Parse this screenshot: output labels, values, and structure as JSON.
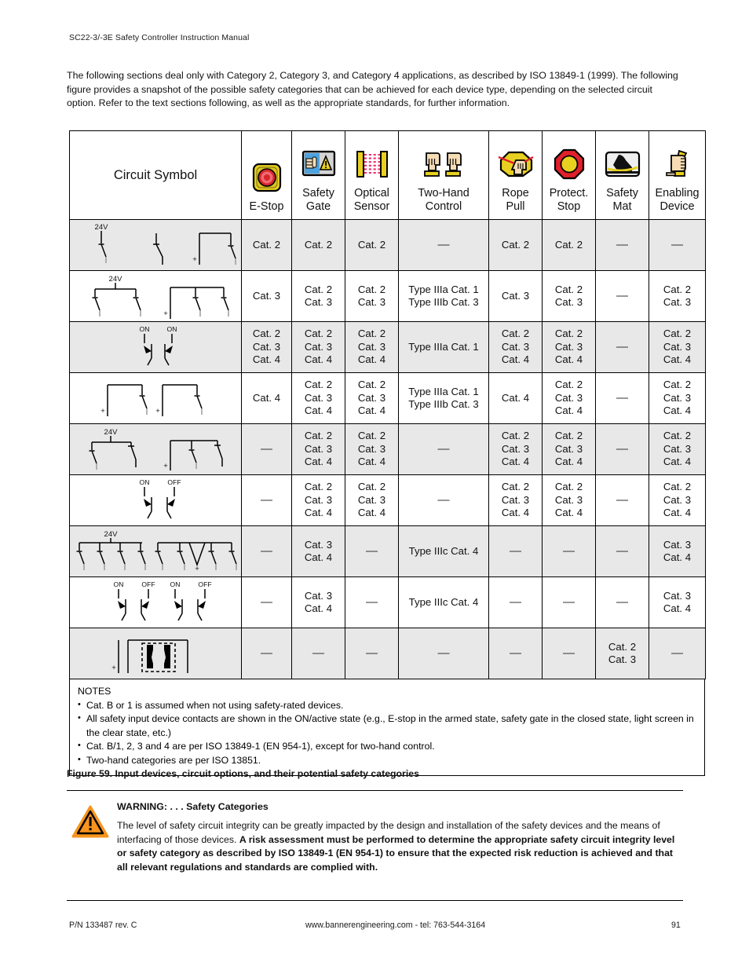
{
  "running_head": "SC22-3/-3E Safety Controller Instruction Manual",
  "intro_paragraph": "The following sections deal only with Category 2, Category 3, and Category 4 applications, as described by ISO 13849-1 (1999). The following figure provides a snapshot of the possible safety categories that can be achieved for each device type, depending on the selected circuit option. Refer to the text sections following, as well as the appropriate standards, for further information.",
  "table": {
    "symbol_header": "Circuit Symbol",
    "columns": [
      {
        "label": "E-Stop",
        "icon": "e-stop-icon"
      },
      {
        "label": "Safety\nGate",
        "line1": "Safety",
        "line2": "Gate",
        "icon": "safety-gate-icon"
      },
      {
        "label": "Optical Sensor",
        "line1": "Optical",
        "line2": "Sensor",
        "icon": "optical-sensor-icon"
      },
      {
        "label": "Two-Hand Control",
        "line1": "Two-Hand",
        "line2": "Control",
        "icon": "two-hand-control-icon"
      },
      {
        "label": "Rope Pull",
        "line1": "Rope",
        "line2": "Pull",
        "icon": "rope-pull-icon"
      },
      {
        "label": "Protect. Stop",
        "line1": "Protect.",
        "line2": "Stop",
        "icon": "protective-stop-icon"
      },
      {
        "label": "Safety Mat",
        "line1": "Safety",
        "line2": "Mat",
        "icon": "safety-mat-icon"
      },
      {
        "label": "Enabling Device",
        "line1": "Enabling",
        "line2": "Device",
        "icon": "enabling-device-icon"
      }
    ],
    "rows": [
      {
        "circuit": "single-contact-24v",
        "shaded": true,
        "cells": [
          [
            "Cat. 2"
          ],
          [
            "Cat. 2"
          ],
          [
            "Cat. 2"
          ],
          [
            "—"
          ],
          [
            "Cat. 2"
          ],
          [
            "Cat. 2"
          ],
          [
            "—"
          ],
          [
            "—"
          ]
        ]
      },
      {
        "circuit": "dual-contact-24v",
        "shaded": false,
        "cells": [
          [
            "Cat. 3"
          ],
          [
            "Cat. 2",
            "Cat. 3"
          ],
          [
            "Cat. 2",
            "Cat. 3"
          ],
          [
            "Type IIIa Cat. 1",
            "Type IIIb Cat. 3"
          ],
          [
            "Cat. 3"
          ],
          [
            "Cat. 2",
            "Cat. 3"
          ],
          [
            "—"
          ],
          [
            "Cat. 2",
            "Cat. 3"
          ]
        ]
      },
      {
        "circuit": "ossd-on-on",
        "shaded": true,
        "cells": [
          [
            "Cat. 2",
            "Cat. 3",
            "Cat. 4"
          ],
          [
            "Cat. 2",
            "Cat. 3",
            "Cat. 4"
          ],
          [
            "Cat. 2",
            "Cat. 3",
            "Cat. 4"
          ],
          [
            "Type IIIa Cat. 1"
          ],
          [
            "Cat. 2",
            "Cat. 3",
            "Cat. 4"
          ],
          [
            "Cat. 2",
            "Cat. 3",
            "Cat. 4"
          ],
          [
            "—"
          ],
          [
            "Cat. 2",
            "Cat. 3",
            "Cat. 4"
          ]
        ]
      },
      {
        "circuit": "two-isolated-contacts",
        "shaded": false,
        "cells": [
          [
            "Cat. 4"
          ],
          [
            "Cat. 2",
            "Cat. 3",
            "Cat. 4"
          ],
          [
            "Cat. 2",
            "Cat. 3",
            "Cat. 4"
          ],
          [
            "Type IIIa Cat. 1",
            "Type IIIb Cat. 3"
          ],
          [
            "Cat. 4"
          ],
          [
            "Cat. 2",
            "Cat. 3",
            "Cat. 4"
          ],
          [
            "—"
          ],
          [
            "Cat. 2",
            "Cat. 3",
            "Cat. 4"
          ]
        ]
      },
      {
        "circuit": "dual-nc-24v",
        "shaded": true,
        "cells": [
          [
            "—"
          ],
          [
            "Cat. 2",
            "Cat. 3",
            "Cat. 4"
          ],
          [
            "Cat. 2",
            "Cat. 3",
            "Cat. 4"
          ],
          [
            "—"
          ],
          [
            "Cat. 2",
            "Cat. 3",
            "Cat. 4"
          ],
          [
            "Cat. 2",
            "Cat. 3",
            "Cat. 4"
          ],
          [
            "—"
          ],
          [
            "Cat. 2",
            "Cat. 3",
            "Cat. 4"
          ]
        ]
      },
      {
        "circuit": "ossd-on-off",
        "shaded": false,
        "cells": [
          [
            "—"
          ],
          [
            "Cat. 2",
            "Cat. 3",
            "Cat. 4"
          ],
          [
            "Cat. 2",
            "Cat. 3",
            "Cat. 4"
          ],
          [
            "—"
          ],
          [
            "Cat. 2",
            "Cat. 3",
            "Cat. 4"
          ],
          [
            "Cat. 2",
            "Cat. 3",
            "Cat. 4"
          ],
          [
            "—"
          ],
          [
            "Cat. 2",
            "Cat. 3",
            "Cat. 4"
          ]
        ]
      },
      {
        "circuit": "four-contact-24v",
        "shaded": true,
        "cells": [
          [
            "—"
          ],
          [
            "Cat. 3",
            "Cat. 4"
          ],
          [
            "—"
          ],
          [
            "Type IIIc Cat. 4"
          ],
          [
            "—"
          ],
          [
            "—"
          ],
          [
            "—"
          ],
          [
            "Cat. 3",
            "Cat. 4"
          ]
        ]
      },
      {
        "circuit": "ossd-on-off-on-off",
        "shaded": false,
        "cells": [
          [
            "—"
          ],
          [
            "Cat. 3",
            "Cat. 4"
          ],
          [
            "—"
          ],
          [
            "Type IIIc Cat. 4"
          ],
          [
            "—"
          ],
          [
            "—"
          ],
          [
            "—"
          ],
          [
            "Cat. 3",
            "Cat. 4"
          ]
        ]
      },
      {
        "circuit": "safety-mat-4-wire",
        "shaded": true,
        "cells": [
          [
            "—"
          ],
          [
            "—"
          ],
          [
            "—"
          ],
          [
            "—"
          ],
          [
            "—"
          ],
          [
            "—"
          ],
          [
            "Cat. 2",
            "Cat. 3"
          ],
          [
            "—"
          ]
        ]
      }
    ],
    "circuit_labels": {
      "v24": "24V",
      "on": "ON",
      "off": "OFF",
      "plus": "+"
    }
  },
  "notes": {
    "title": "NOTES",
    "items": [
      "Cat. B or 1 is assumed when not using safety-rated devices.",
      "All safety input device contacts are shown in the ON/active state (e.g., E-stop in the armed state, safety gate in the closed state, light screen in the clear state, etc.)",
      "Cat. B/1, 2, 3 and 4 are per ISO 13849-1 (EN 954-1), except for two-hand control.",
      "Two-hand categories are per ISO 13851."
    ]
  },
  "figure_caption": "Figure 59. Input devices, circuit options, and their potential safety categories",
  "warning": {
    "icon": "warning-triangle-icon",
    "heading": "WARNING: . . . Safety Categories",
    "text_normal_1": "The level of safety circuit integrity can be greatly impacted by the design and installation of the safety devices and the means of interfacing of those devices. ",
    "text_bold": "A risk assessment must be performed to determine the appropriate safety circuit integrity level or safety category as described by ISO 13849-1 (EN 954-1) to ensure that the expected risk reduction is achieved and that all relevant regulations and standards are complied with."
  },
  "footer": {
    "left": "P/N 133487 rev. C",
    "center": "www.bannerengineering.com - tel: 763-544-3164",
    "right": "91"
  },
  "colors": {
    "icon_yellow": "#f2d117",
    "icon_red": "#e0202a",
    "icon_blue": "#4ea3dd",
    "icon_skin": "#f5dcb4",
    "icon_gray": "#c9c9c9",
    "warning_orange": "#f7941e",
    "row_shade": "#e8e8e8"
  }
}
